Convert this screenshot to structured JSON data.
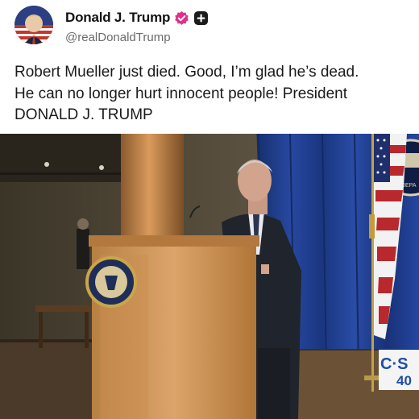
{
  "author": {
    "display_name": "Donald J. Trump",
    "handle": "@realDonaldTrump"
  },
  "post": {
    "text": "Robert Mueller just died. Good, I’m glad he’s dead.\nHe can no longer hurt innocent people! President\nDONALD J. TRUMP"
  },
  "media": {
    "banner_text": "DEPA",
    "channel_logo": "C·S",
    "channel_number": "40"
  },
  "colors": {
    "verified_badge": "#e0308f",
    "text": "#1a1a1a",
    "handle": "#6b6b6b",
    "curtain": "#1f3a8c",
    "podium": "#c9925a"
  },
  "icons": [
    "avatar",
    "verified-badge-icon",
    "add-badge-icon",
    "justice-seal-icon",
    "american-flag"
  ]
}
